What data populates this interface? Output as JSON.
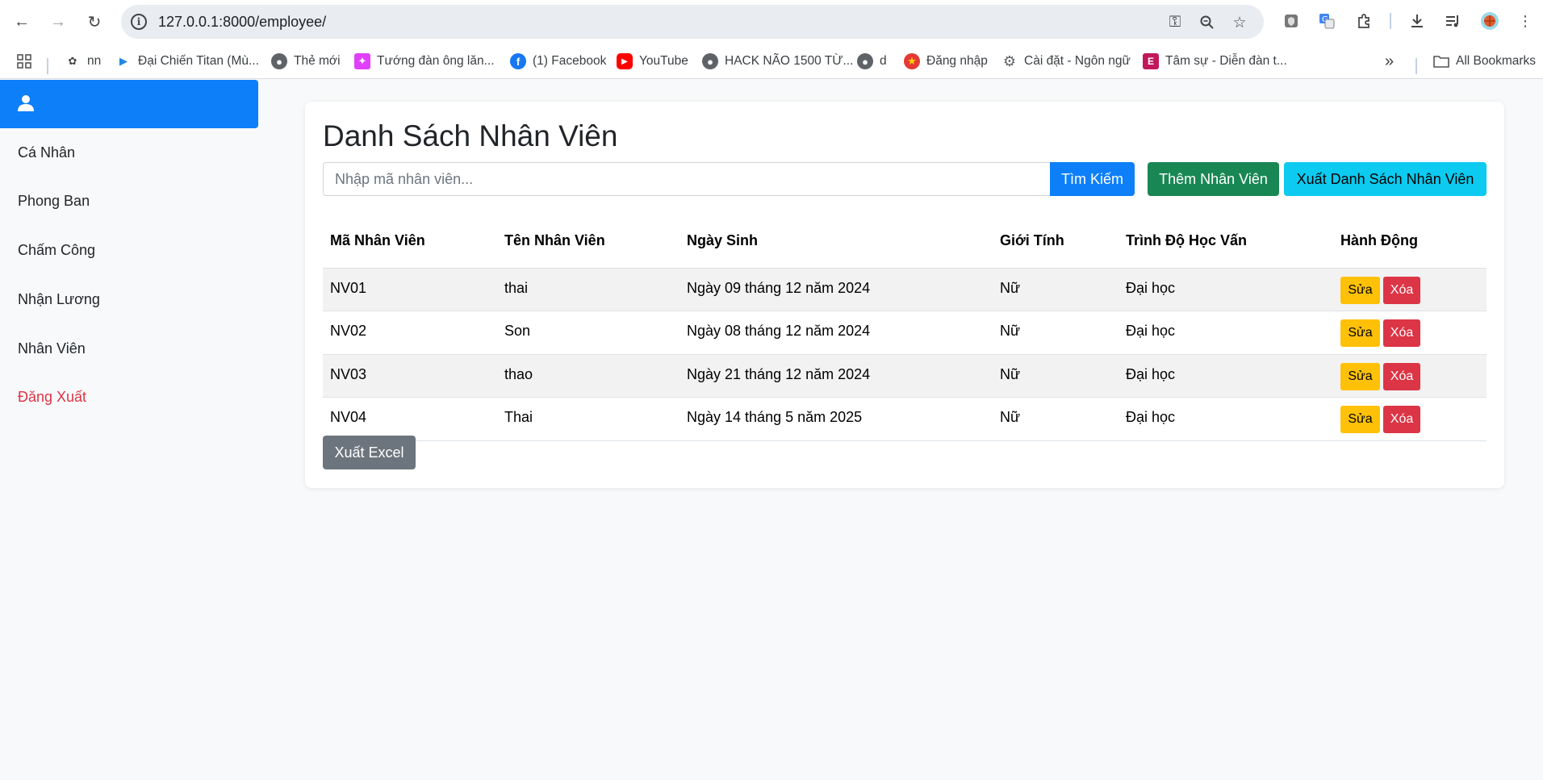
{
  "browser": {
    "url": "127.0.0.1:8000/employee/",
    "bookmarks": [
      {
        "label": "nn",
        "icon": "bookmark-icon"
      },
      {
        "label": "Đại Chiến Titan (Mù...",
        "icon": "play-icon"
      },
      {
        "label": "Thẻ mới",
        "icon": "globe-icon"
      },
      {
        "label": "Tướng đàn ông lăn...",
        "icon": "image-icon"
      },
      {
        "label": "(1) Facebook",
        "icon": "facebook-icon"
      },
      {
        "label": "YouTube",
        "icon": "youtube-icon"
      },
      {
        "label": "HACK NÃO 1500 TỪ...",
        "icon": "globe-icon"
      },
      {
        "label": "d",
        "icon": "globe-icon"
      },
      {
        "label": "Đăng nhập",
        "icon": "emblem-icon"
      },
      {
        "label": "Cài đặt - Ngôn ngữ",
        "icon": "gear-icon"
      },
      {
        "label": "Tâm sự - Diễn đàn t...",
        "icon": "forum-icon"
      }
    ],
    "all_bookmarks": "All Bookmarks"
  },
  "sidebar": {
    "items": [
      {
        "label": "Cá Nhân"
      },
      {
        "label": "Phong Ban"
      },
      {
        "label": "Chấm Công"
      },
      {
        "label": "Nhận Lương"
      },
      {
        "label": "Nhân Viên"
      },
      {
        "label": "Đăng Xuất"
      }
    ]
  },
  "main": {
    "title": "Danh Sách Nhân Viên",
    "search_placeholder": "Nhập mã nhân viên...",
    "search_button": "Tìm Kiếm",
    "add_button": "Thêm Nhân Viên",
    "export_list_button": "Xuất Danh Sách Nhân Viên",
    "export_excel_button": "Xuất Excel",
    "table": {
      "headers": [
        "Mã Nhân Viên",
        "Tên Nhân Viên",
        "Ngày Sinh",
        "Giới Tính",
        "Trình Độ Học Vấn",
        "Hành Động"
      ],
      "rows": [
        {
          "id": "NV01",
          "name": "thai",
          "dob": "Ngày 09 tháng 12 năm 2024",
          "gender": "Nữ",
          "education": "Đại học"
        },
        {
          "id": "NV02",
          "name": "Son",
          "dob": "Ngày 08 tháng 12 năm 2024",
          "gender": "Nữ",
          "education": "Đại học"
        },
        {
          "id": "NV03",
          "name": "thao",
          "dob": "Ngày 21 tháng 12 năm 2024",
          "gender": "Nữ",
          "education": "Đại học"
        },
        {
          "id": "NV04",
          "name": "Thai",
          "dob": "Ngày 14 tháng 5 năm 2025",
          "gender": "Nữ",
          "education": "Đại học"
        }
      ],
      "edit_label": "Sửa",
      "delete_label": "Xóa"
    }
  },
  "colors": {
    "primary": "#0d7ff8",
    "success": "#198754",
    "info": "#0dcaf0",
    "warning": "#ffc107",
    "danger": "#dc3545",
    "secondary": "#6c757d"
  }
}
